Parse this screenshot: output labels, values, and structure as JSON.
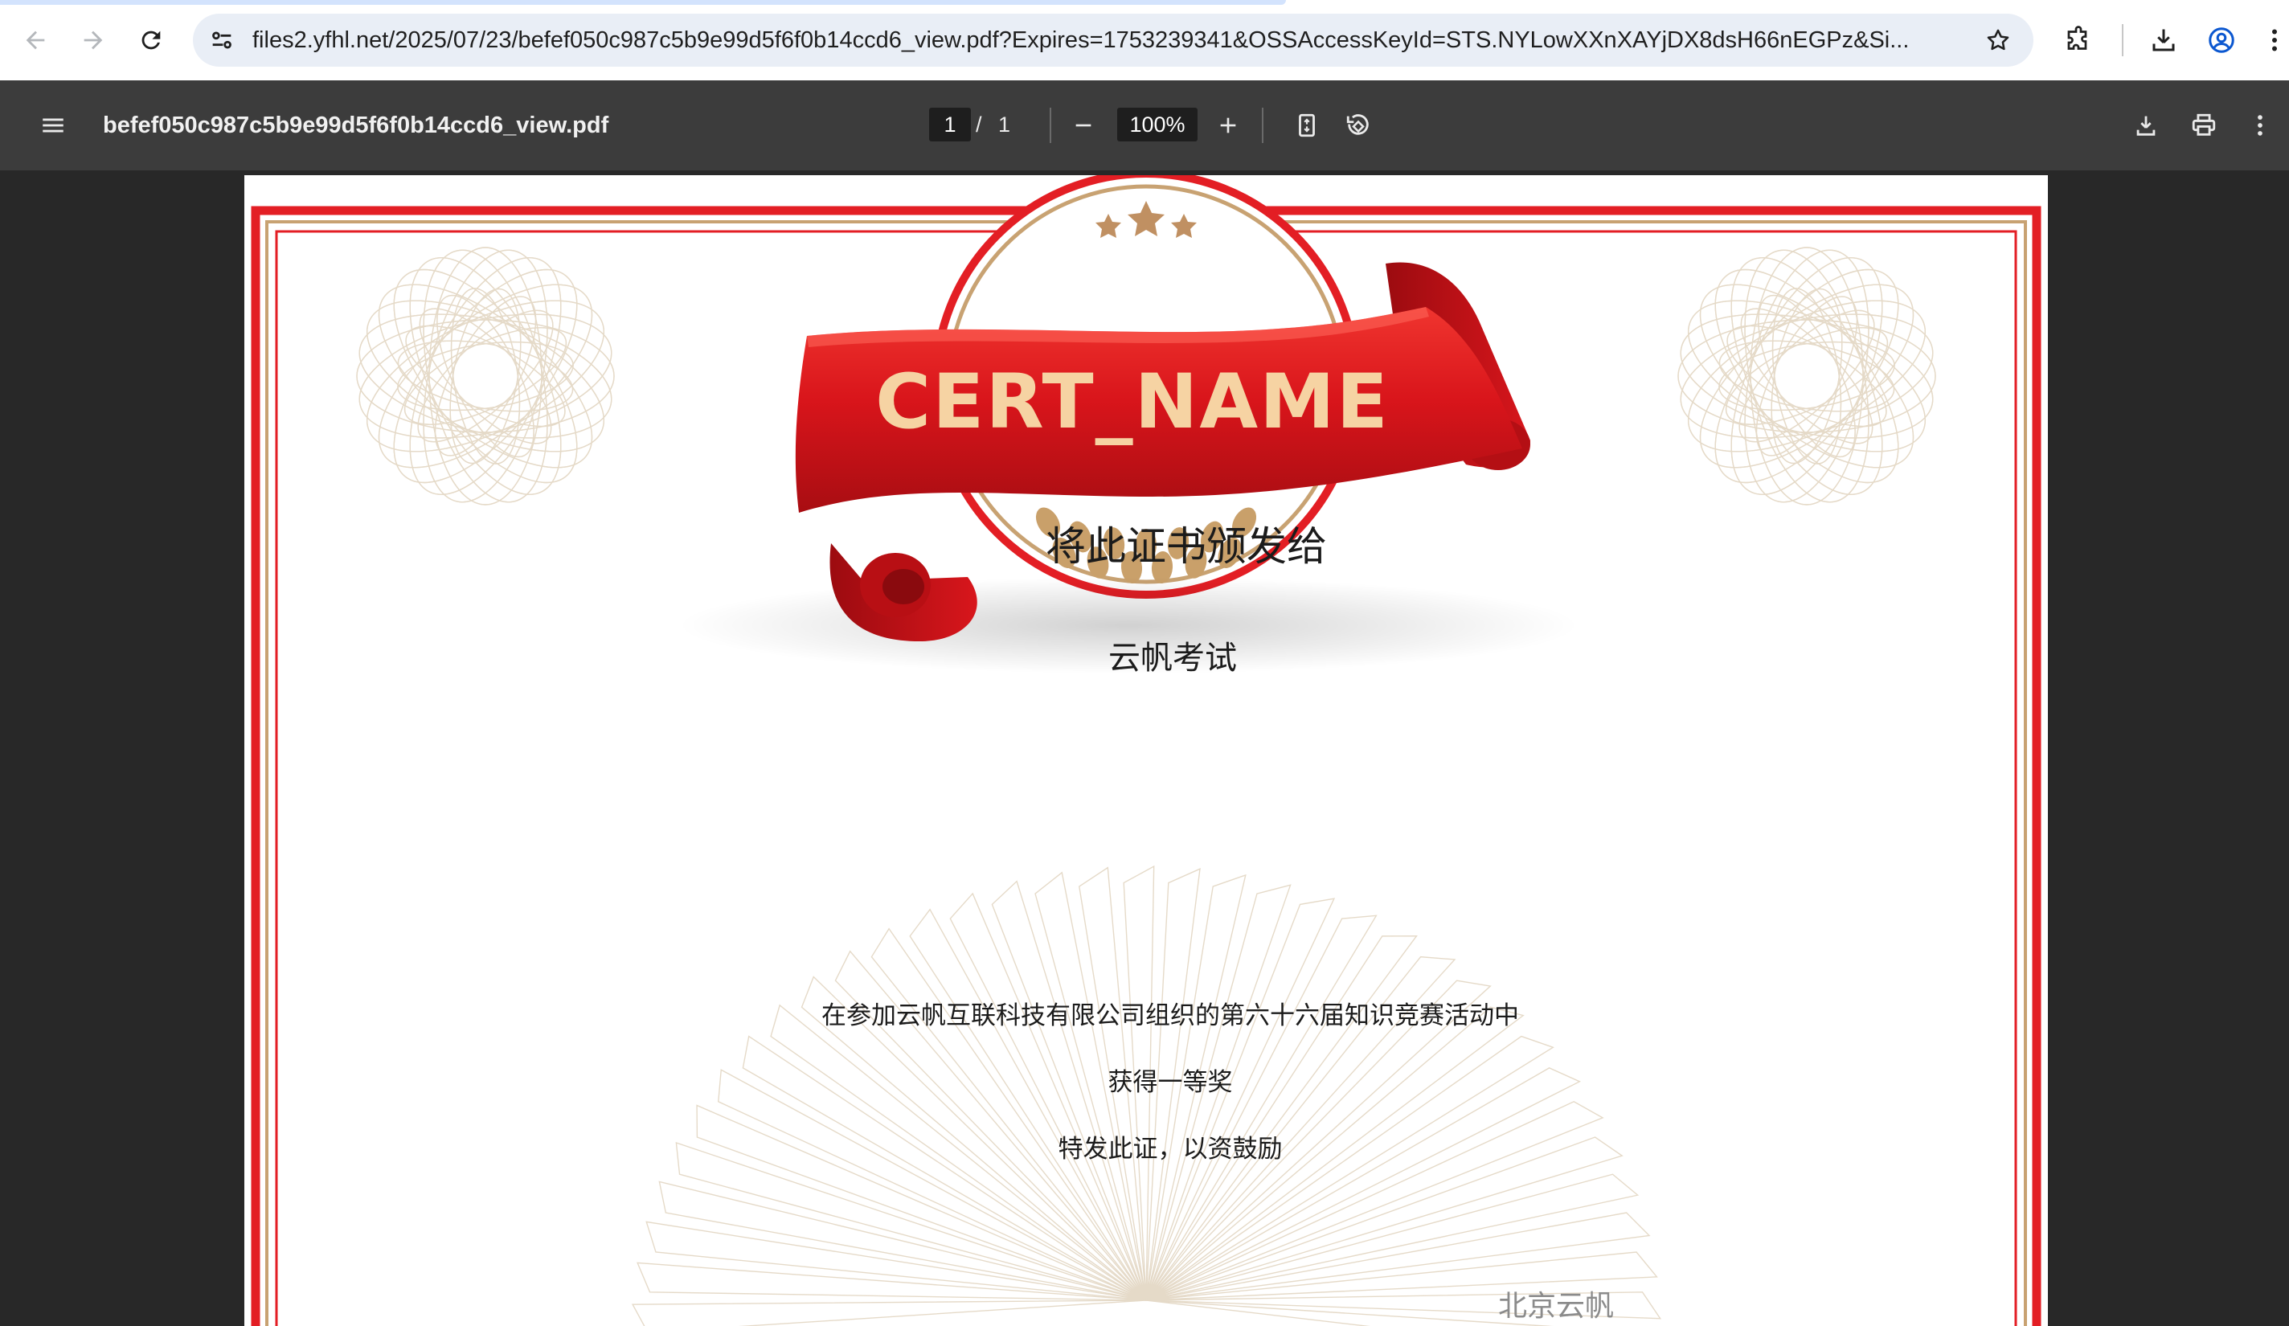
{
  "browser": {
    "url": "files2.yfhl.net/2025/07/23/befef050c987c5b9e99d5f6f0b14ccd6_view.pdf?Expires=1753239341&OSSAccessKeyId=STS.NYLowXXnXAYjDX8dsH66nEGPz&Si...",
    "icons": [
      "back-icon",
      "forward-icon",
      "reload-icon",
      "site-info-icon",
      "star-icon",
      "extensions-icon",
      "download-icon",
      "profile-icon",
      "more-vert-icon"
    ]
  },
  "viewer": {
    "file_name": "befef050c987c5b9e99d5f6f0b14ccd6_view.pdf",
    "current_page": "1",
    "page_separator": "/",
    "total_pages": "1",
    "zoom": "100%",
    "icons": [
      "menu-icon",
      "zoom-out-icon",
      "zoom-in-icon",
      "fit-page-icon",
      "rotate-icon",
      "download-icon",
      "print-icon",
      "more-vert-icon"
    ]
  },
  "certificate": {
    "banner_text": "CERT_NAME",
    "title": "将此证书颁发给",
    "recipient": "云帆考试",
    "lines": [
      "在参加云帆互联科技有限公司组织的第六十六届知识竞赛活动中",
      "获得一等奖",
      "特发此证，以资鼓励"
    ],
    "issuer": "北京云帆",
    "colors": {
      "border_red": "#e31e24",
      "inner_gold": "#c8a272",
      "banner_red": "#d9151b",
      "banner_text": "#f6d3a3",
      "guilloche": "#e4d8c6"
    }
  }
}
